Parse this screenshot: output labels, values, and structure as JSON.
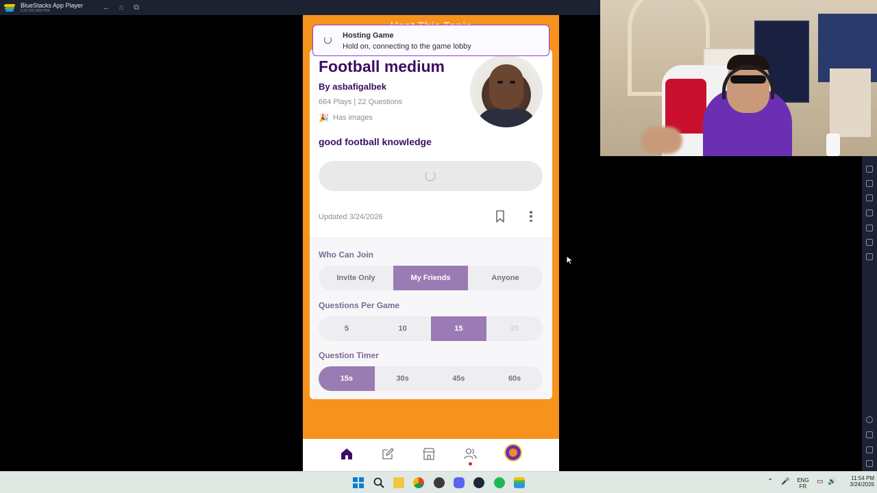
{
  "window": {
    "app_title": "BlueStacks App Player",
    "version": "5.22.150.1003 P64"
  },
  "phone": {
    "header_title": "Host This Topic"
  },
  "toast": {
    "title": "Hosting Game",
    "subtitle": "Hold on, connecting to the game lobby"
  },
  "quiz": {
    "title": "Football medium",
    "author": "By asbafigalbek",
    "stats": "664 Plays | 22 Questions",
    "has_images": "Has images",
    "description": "good football knowledge",
    "updated": "Updated 3/24/2026"
  },
  "settings": {
    "who_can_join": {
      "label": "Who Can Join",
      "options": [
        "Invite Only",
        "My Friends",
        "Anyone"
      ],
      "selected": "My Friends"
    },
    "questions_per_game": {
      "label": "Questions Per Game",
      "options": [
        "5",
        "10",
        "15",
        "20"
      ],
      "selected": "15",
      "disabled": [
        "20"
      ]
    },
    "question_timer": {
      "label": "Question Timer",
      "options": [
        "15s",
        "30s",
        "45s",
        "60s"
      ],
      "selected": "15s"
    }
  },
  "bottom_nav": {
    "items": [
      "home-icon",
      "edit-icon",
      "store-icon",
      "friends-icon",
      "profile-avatar"
    ],
    "active": "home-icon",
    "accent": "#3b0d63"
  },
  "taskbar": {
    "lang_top": "ENG",
    "lang_bottom": "FR",
    "time": "11:54 PM",
    "date": "3/24/2026"
  },
  "colors": {
    "app_background": "#f7921c",
    "accent_purple": "#9b7bb3",
    "title_purple": "#3b0d63",
    "toast_border": "#8b3fd6"
  }
}
